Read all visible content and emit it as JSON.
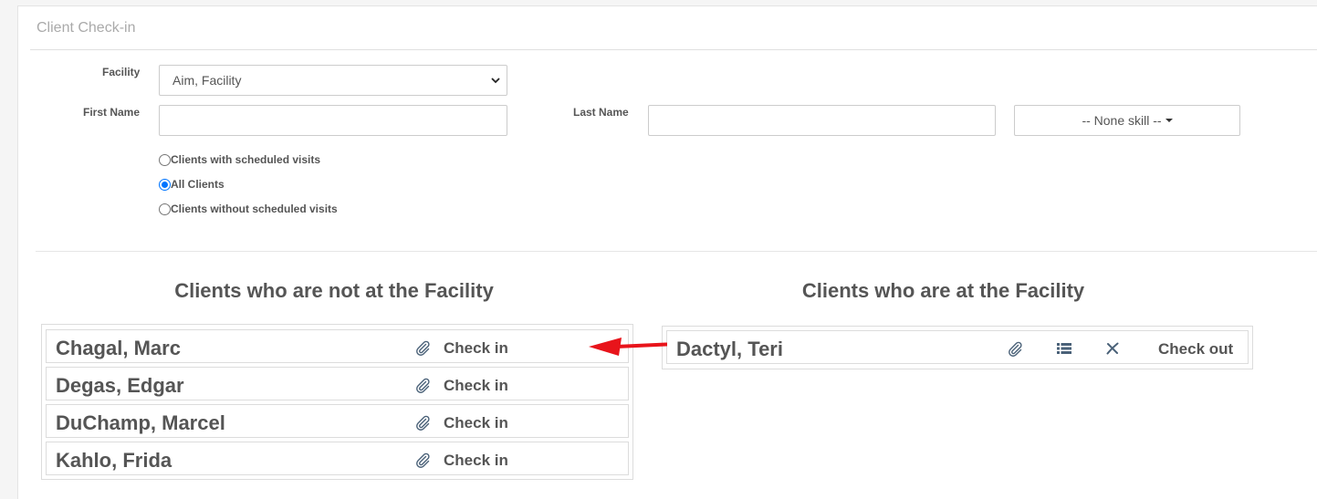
{
  "panel": {
    "title": "Client Check-in"
  },
  "filters": {
    "facility_label": "Facility",
    "facility_value": "Aim, Facility",
    "first_name_label": "First Name",
    "first_name_value": "",
    "last_name_label": "Last Name",
    "last_name_value": "",
    "skill_label": "-- None skill --",
    "radios": [
      {
        "label": "Clients with scheduled visits",
        "checked": false
      },
      {
        "label": "All Clients",
        "checked": true
      },
      {
        "label": "Clients without scheduled visits",
        "checked": false
      }
    ]
  },
  "not_at_facility": {
    "heading": "Clients who are not at the Facility",
    "action_label": "Check in",
    "clients": [
      "Chagal, Marc",
      "Degas, Edgar",
      "DuChamp, Marcel",
      "Kahlo, Frida"
    ]
  },
  "at_facility": {
    "heading": "Clients who are at the Facility",
    "action_label": "Check out",
    "clients": [
      "Dactyl, Teri"
    ]
  },
  "icons": {
    "attach": "paperclip-icon",
    "list": "list-icon",
    "remove": "close-icon",
    "annotation": "red-arrow-left"
  },
  "colors": {
    "accent_radio": "#0075ff",
    "annotation_arrow": "#e8141b",
    "text": "#555555",
    "icon": "#4a6178"
  }
}
